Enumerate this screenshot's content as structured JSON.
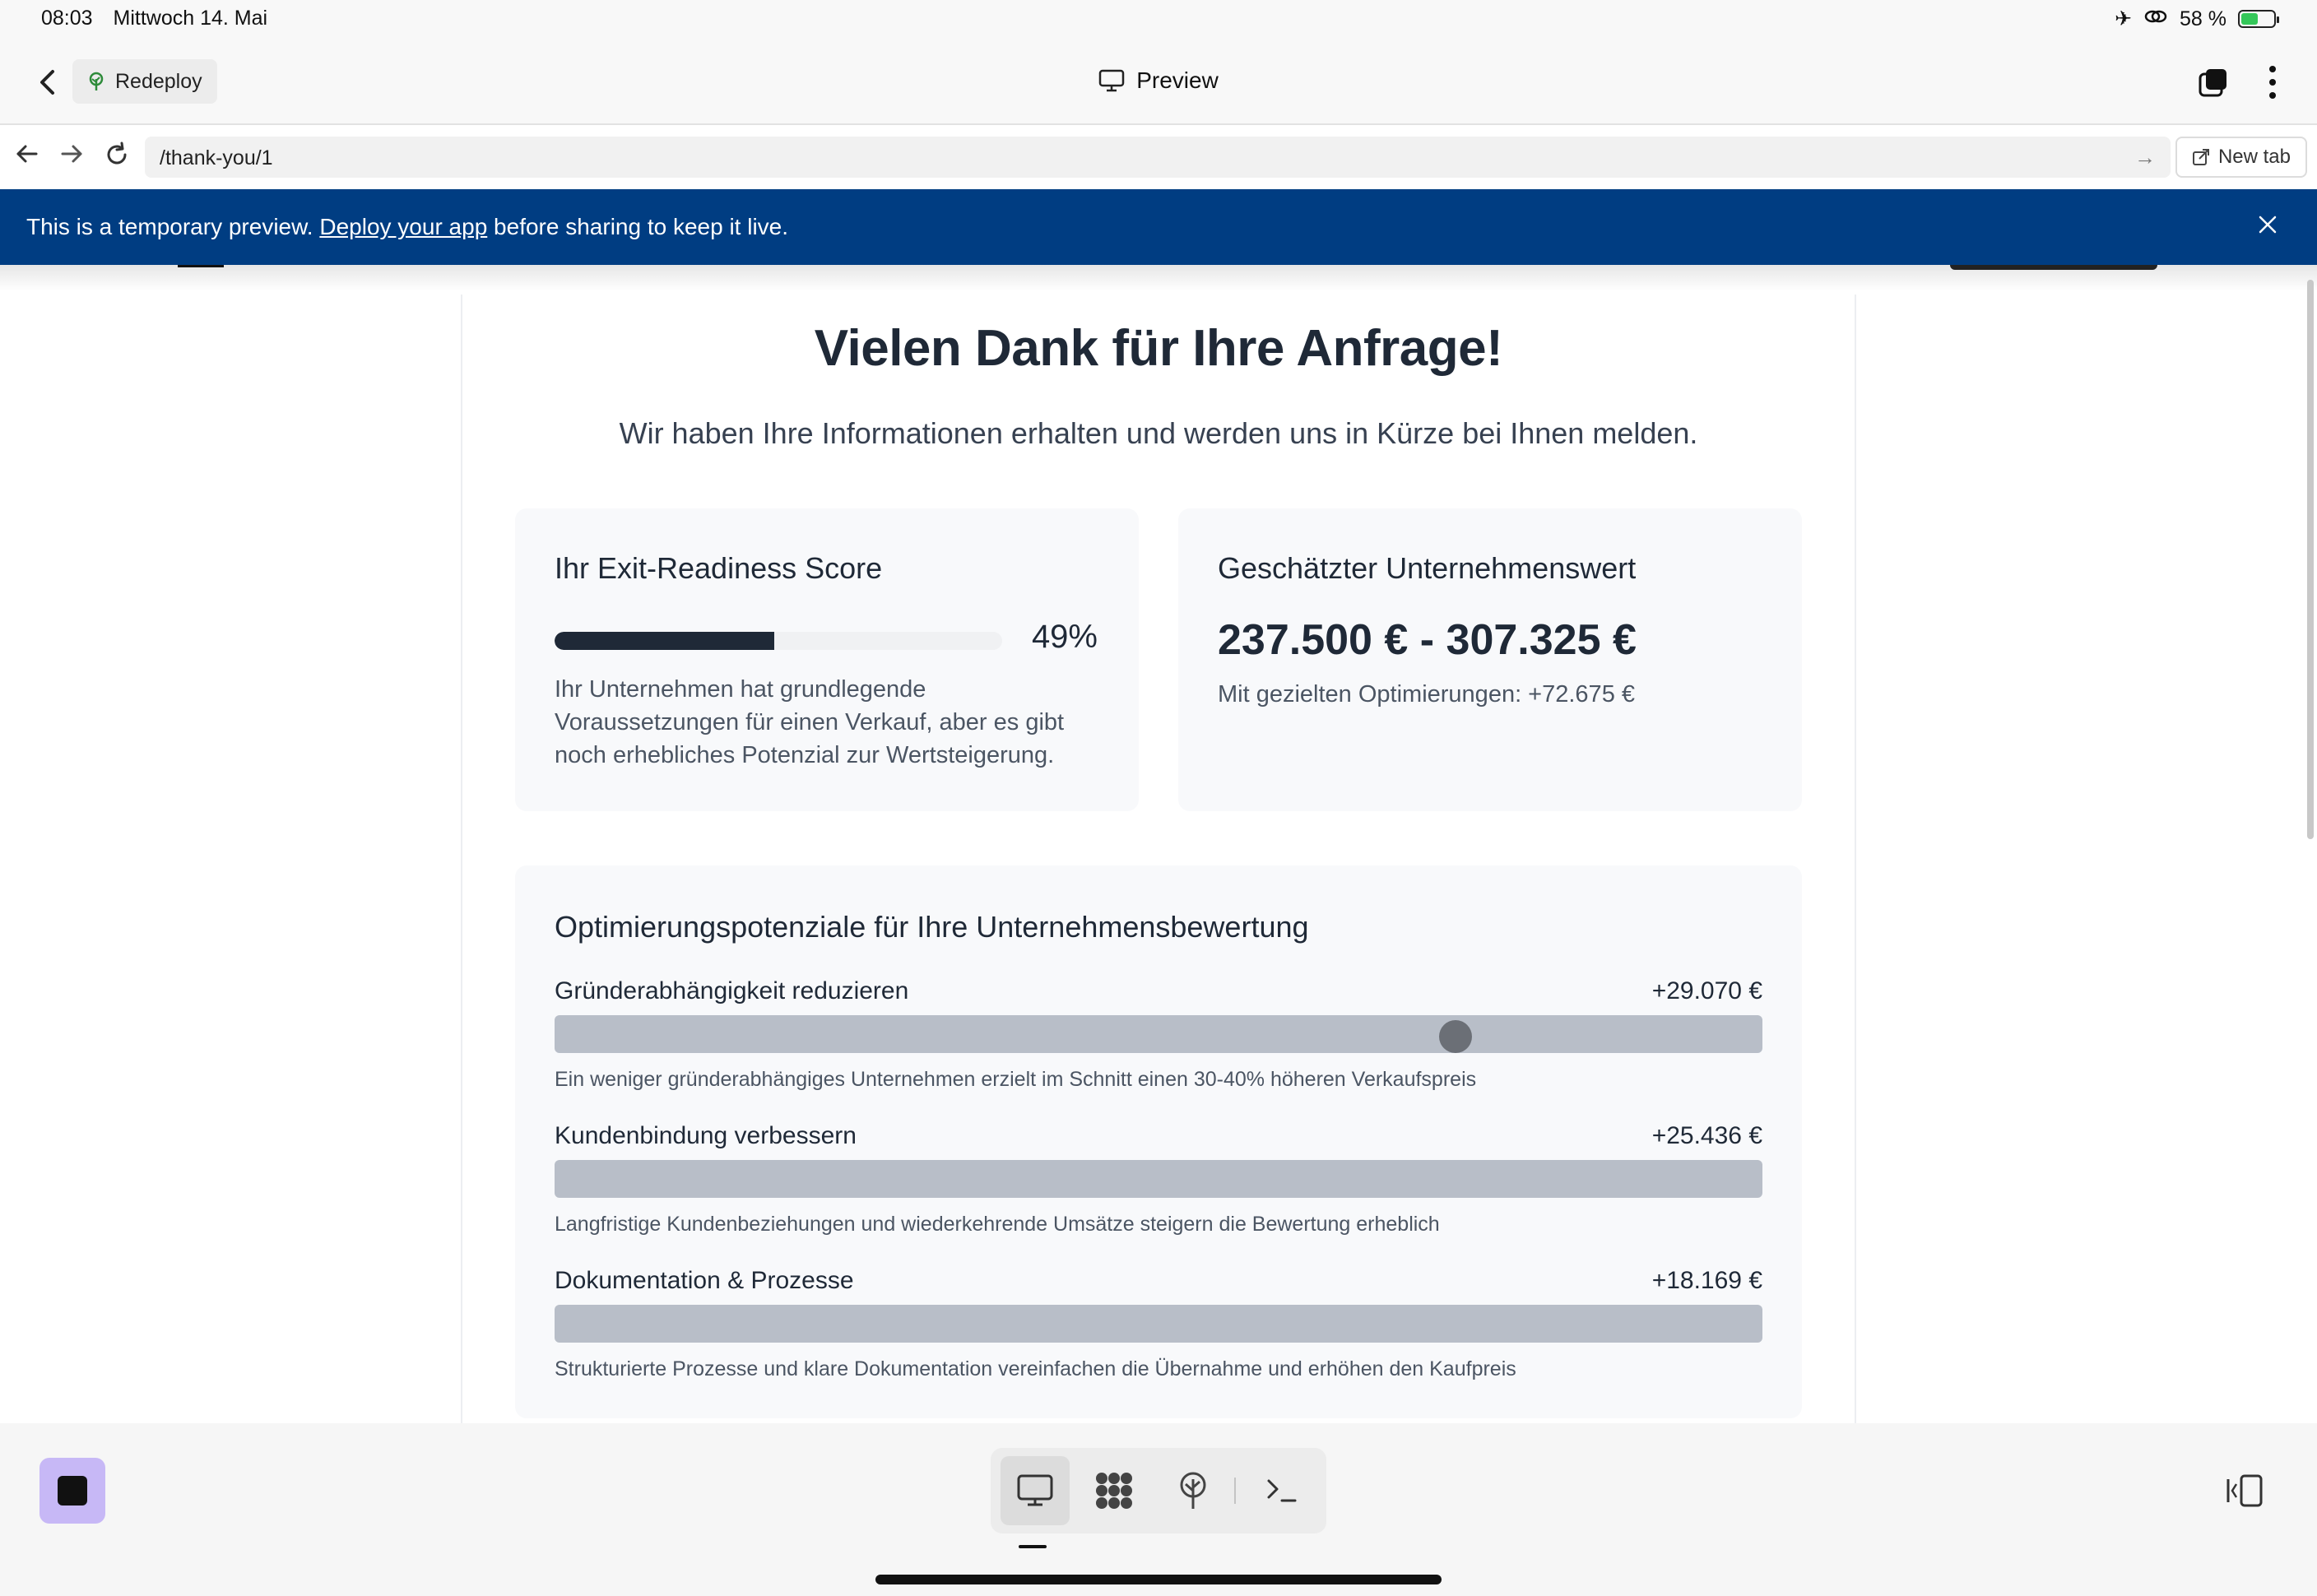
{
  "status": {
    "time": "08:03",
    "date": "Mittwoch 14. Mai",
    "battery": "58 %",
    "battery_level": 0.58
  },
  "toolbar": {
    "redeploy_label": "Redeploy",
    "title": "Preview"
  },
  "urlbar": {
    "url": "/thank-you/1",
    "new_tab_label": "New tab"
  },
  "banner": {
    "text_before": "This is a temporary preview.",
    "link": "Deploy your app",
    "text_after": "before sharing to keep it live."
  },
  "page": {
    "heading": "Vielen Dank für Ihre Anfrage!",
    "subheading": "Wir haben Ihre Informationen erhalten und werden uns in Kürze bei Ihnen melden.",
    "score": {
      "title": "Ihr Exit-Readiness Score",
      "value": 0.49,
      "percent_label": "49%",
      "description": "Ihr Unternehmen hat grundlegende Voraussetzungen für einen Verkauf, aber es gibt noch erhebliches Potenzial zur Wertsteigerung."
    },
    "valuation": {
      "title": "Geschätzter Unternehmenswert",
      "range": "237.500 € - 307.325 €",
      "note": "Mit gezielten Optimierungen: +72.675 €"
    },
    "optimizations": {
      "title": "Optimierungspotenziale für Ihre Unternehmensbewertung",
      "items": [
        {
          "label": "Gründerabhängigkeit reduzieren",
          "value": "+29.070 €",
          "description": "Ein weniger gründerabhängiges Unternehmen erzielt im Schnitt einen 30-40% höheren Verkaufspreis",
          "slider_position": 0.746
        },
        {
          "label": "Kundenbindung verbessern",
          "value": "+25.436 €",
          "description": "Langfristige Kundenbeziehungen und wiederkehrende Umsätze steigern die Bewertung erheblich"
        },
        {
          "label": "Dokumentation & Prozesse",
          "value": "+18.169 €",
          "description": "Strukturierte Prozesse und klare Dokumentation vereinfachen die Übernahme und erhöhen den Kaufpreis"
        }
      ]
    }
  },
  "icons": {
    "status": [
      "airplane-icon",
      "link-icon",
      "battery-icon"
    ],
    "toolbar": [
      "chevron-left-icon",
      "tree-icon",
      "monitor-icon",
      "tabs-icon",
      "more-vertical-icon"
    ],
    "urlbar": [
      "arrow-left-icon",
      "arrow-right-icon",
      "reload-icon",
      "arrow-go-icon",
      "external-link-icon"
    ],
    "dock": [
      "stop-icon",
      "monitor-icon",
      "grid-icon",
      "tree-icon",
      "terminal-icon",
      "panel-icon"
    ]
  },
  "colors": {
    "banner": "#003d82",
    "score_fill": "#1f2937",
    "opt_bar": "#b8bec8",
    "stop_button": "#c7b8f6"
  }
}
